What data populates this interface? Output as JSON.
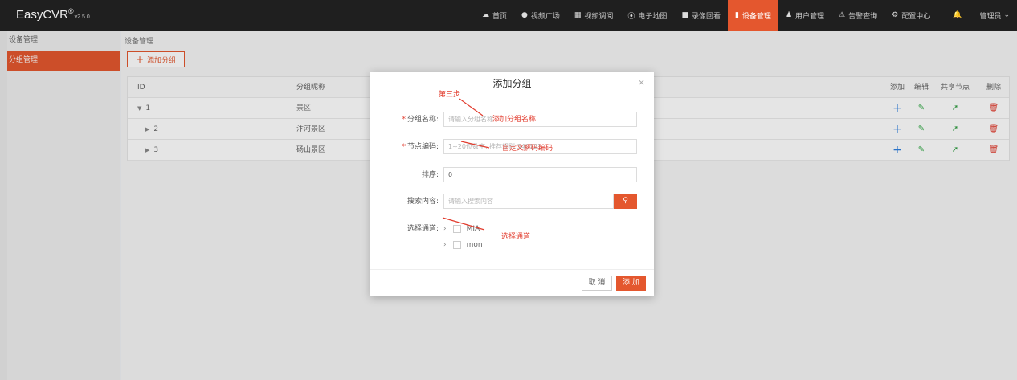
{
  "app": {
    "logo_text": "EasyCVR",
    "logo_mark": "®",
    "version": "v2.5.0"
  },
  "nav": [
    {
      "icon": "cloud-icon",
      "glyph": "☁",
      "label": "首页",
      "active": false
    },
    {
      "icon": "play-icon",
      "glyph": "●",
      "label": "视频广场",
      "active": false
    },
    {
      "icon": "grid-icon",
      "glyph": "▦",
      "label": "视频调阅",
      "active": false
    },
    {
      "icon": "map-pin-icon",
      "glyph": "⦿",
      "label": "电子地图",
      "active": false
    },
    {
      "icon": "video-camera-icon",
      "glyph": "■",
      "label": "录像回看",
      "active": false
    },
    {
      "icon": "device-icon",
      "glyph": "▮",
      "label": "设备管理",
      "active": true
    },
    {
      "icon": "user-icon",
      "glyph": "♟",
      "label": "用户管理",
      "active": false
    },
    {
      "icon": "alarm-icon",
      "glyph": "⚠",
      "label": "告警查询",
      "active": false
    },
    {
      "icon": "gear-icon",
      "glyph": "⚙",
      "label": "配置中心",
      "active": false
    }
  ],
  "nav_bell_glyph": "🔔",
  "user": {
    "label": "管理员",
    "chevron": "⌄"
  },
  "sidebar": {
    "items": [
      {
        "label": "设备管理",
        "active": false
      },
      {
        "label": "分组管理",
        "active": true
      }
    ]
  },
  "breadcrumb": "设备管理",
  "toolbar": {
    "add_label": "添加分组",
    "plus": "+"
  },
  "table": {
    "headers": {
      "id": "ID",
      "name": "分组昵称",
      "add": "添加",
      "edit": "编辑",
      "share": "共享节点",
      "del": "删除"
    },
    "rows": [
      {
        "id": "1",
        "name": "景区",
        "tri": "▼",
        "indent": false
      },
      {
        "id": "2",
        "name": "汴河景区",
        "tri": "▶",
        "indent": true
      },
      {
        "id": "3",
        "name": "砀山景区",
        "tri": "▶",
        "indent": true
      }
    ],
    "action_glyphs": {
      "add": "+",
      "edit": "✎",
      "share": "➚",
      "del": "🗑"
    }
  },
  "modal": {
    "title": "添加分组",
    "close": "×",
    "step": "第三步",
    "fields": {
      "name": {
        "label": "分组名称:",
        "placeholder": "请输入分组名称"
      },
      "code": {
        "label": "节点编码:",
        "placeholder": "1~20位数字, 推荐规则 340121"
      },
      "sort": {
        "label": "排序:",
        "value": "0"
      },
      "search": {
        "label": "搜索内容:",
        "placeholder": "请输入搜索内容",
        "btn_glyph": "⚲"
      },
      "channels": {
        "label": "选择通道:",
        "items": [
          {
            "label": "MIA"
          },
          {
            "label": "mon"
          }
        ]
      }
    },
    "annotations": {
      "name": "添加分组名称",
      "code": "自定义解码编码",
      "channel": "选择通道"
    },
    "buttons": {
      "cancel": "取 消",
      "submit": "添 加"
    }
  },
  "colors": {
    "accent": "#e4572e",
    "annotation": "#e23c2e",
    "topbar": "#1f1f1f"
  }
}
